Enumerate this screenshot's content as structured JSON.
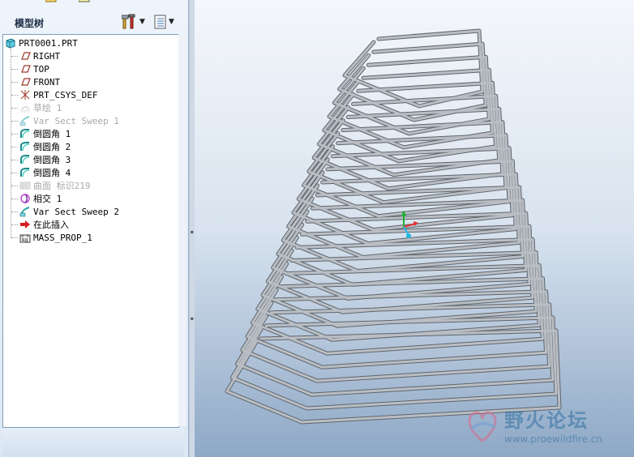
{
  "panel": {
    "title": "模型树",
    "settings_icon": "tools-icon",
    "show_icon": "list-view-icon",
    "dropdown_glyph": "▼"
  },
  "tree": {
    "root": "PRT0001.PRT",
    "items": [
      {
        "label": "RIGHT",
        "icon": "datum-plane-icon",
        "suppressed": false
      },
      {
        "label": "TOP",
        "icon": "datum-plane-icon",
        "suppressed": false
      },
      {
        "label": "FRONT",
        "icon": "datum-plane-icon",
        "suppressed": false
      },
      {
        "label": "PRT_CSYS_DEF",
        "icon": "csys-icon",
        "suppressed": false
      },
      {
        "label": "草绘 1",
        "icon": "sketch-icon",
        "suppressed": true
      },
      {
        "label": "Var Sect Sweep 1",
        "icon": "sweep-icon",
        "suppressed": true
      },
      {
        "label": "倒圆角 1",
        "icon": "round-icon",
        "suppressed": false
      },
      {
        "label": "倒圆角 2",
        "icon": "round-icon",
        "suppressed": false
      },
      {
        "label": "倒圆角 3",
        "icon": "round-icon",
        "suppressed": false
      },
      {
        "label": "倒圆角 4",
        "icon": "round-icon",
        "suppressed": false
      },
      {
        "label": "曲面 标识219",
        "icon": "surface-icon",
        "suppressed": true
      },
      {
        "label": "相交 1",
        "icon": "intersect-icon",
        "suppressed": false
      },
      {
        "label": "Var Sect Sweep 2",
        "icon": "sweep-icon",
        "suppressed": false
      },
      {
        "label": "在此插入",
        "icon": "insert-arrow-icon",
        "suppressed": false
      },
      {
        "label": "MASS_PROP_1",
        "icon": "analysis-icon",
        "suppressed": false
      }
    ]
  },
  "watermark": {
    "title": "野火论坛",
    "url": "www.proewildfire.cn"
  },
  "colors": {
    "wire": "#b9bec4",
    "wire_edge": "#5f656c",
    "viewport_top": "#f4f7fb",
    "viewport_bottom": "#8ea8c6"
  }
}
